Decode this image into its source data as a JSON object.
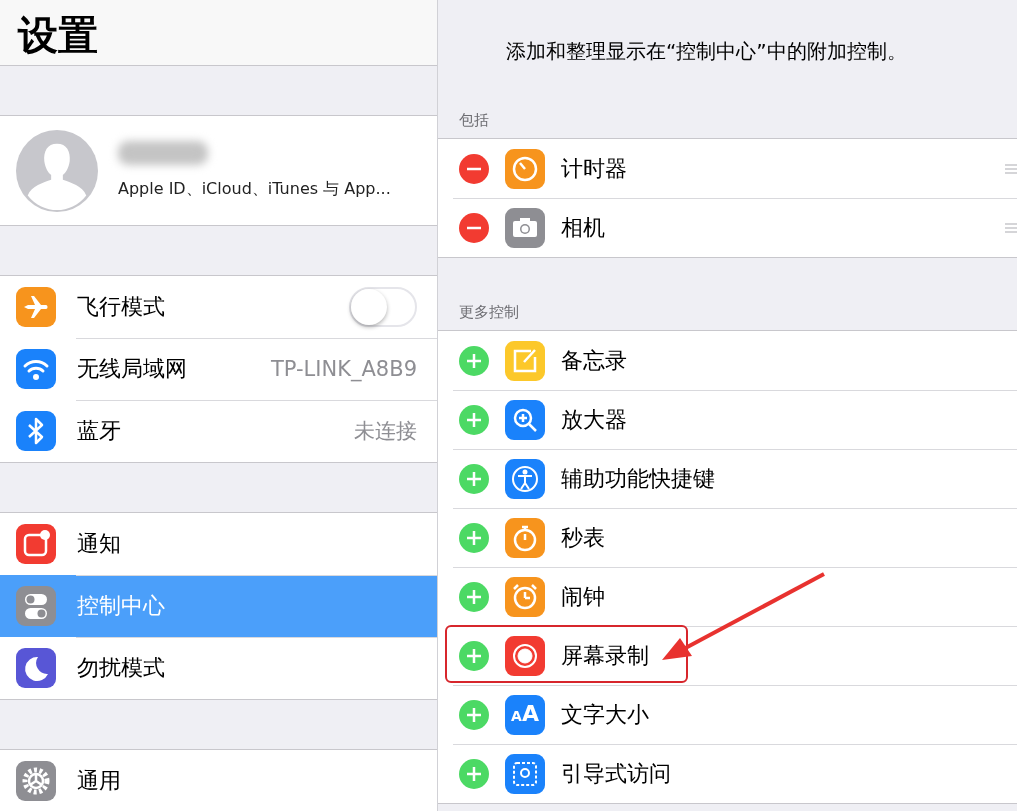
{
  "sidebar": {
    "title": "设置",
    "profile": {
      "subtitle": "Apple ID、iCloud、iTunes 与 App..."
    },
    "groups": [
      [
        {
          "label": "飞行模式",
          "kind": "toggle",
          "on": false,
          "selected": false
        },
        {
          "label": "无线局域网",
          "kind": "value",
          "value": "TP-LINK_A8B9",
          "selected": false
        },
        {
          "label": "蓝牙",
          "kind": "value",
          "value": "未连接",
          "selected": false
        }
      ],
      [
        {
          "label": "通知",
          "kind": "plain",
          "selected": false
        },
        {
          "label": "控制中心",
          "kind": "plain",
          "selected": true
        },
        {
          "label": "勿扰模式",
          "kind": "plain",
          "selected": false
        }
      ],
      [
        {
          "label": "通用",
          "kind": "plain",
          "selected": false
        }
      ]
    ]
  },
  "detail": {
    "description": "添加和整理显示在“控制中心”中的附加控制。",
    "sections": [
      {
        "header": "包括",
        "rows": [
          {
            "label": "计时器",
            "kind": "remove",
            "highlighted": false
          },
          {
            "label": "相机",
            "kind": "remove",
            "highlighted": false
          }
        ]
      },
      {
        "header": "更多控制",
        "rows": [
          {
            "label": "备忘录",
            "kind": "add",
            "highlighted": false
          },
          {
            "label": "放大器",
            "kind": "add",
            "highlighted": false
          },
          {
            "label": "辅助功能快捷键",
            "kind": "add",
            "highlighted": false
          },
          {
            "label": "秒表",
            "kind": "add",
            "highlighted": false
          },
          {
            "label": "闹钟",
            "kind": "add",
            "highlighted": false
          },
          {
            "label": "屏幕录制",
            "kind": "add",
            "highlighted": true
          },
          {
            "label": "文字大小",
            "kind": "add",
            "highlighted": false,
            "icon_text": "AA"
          },
          {
            "label": "引导式访问",
            "kind": "add",
            "highlighted": false
          }
        ]
      }
    ]
  }
}
